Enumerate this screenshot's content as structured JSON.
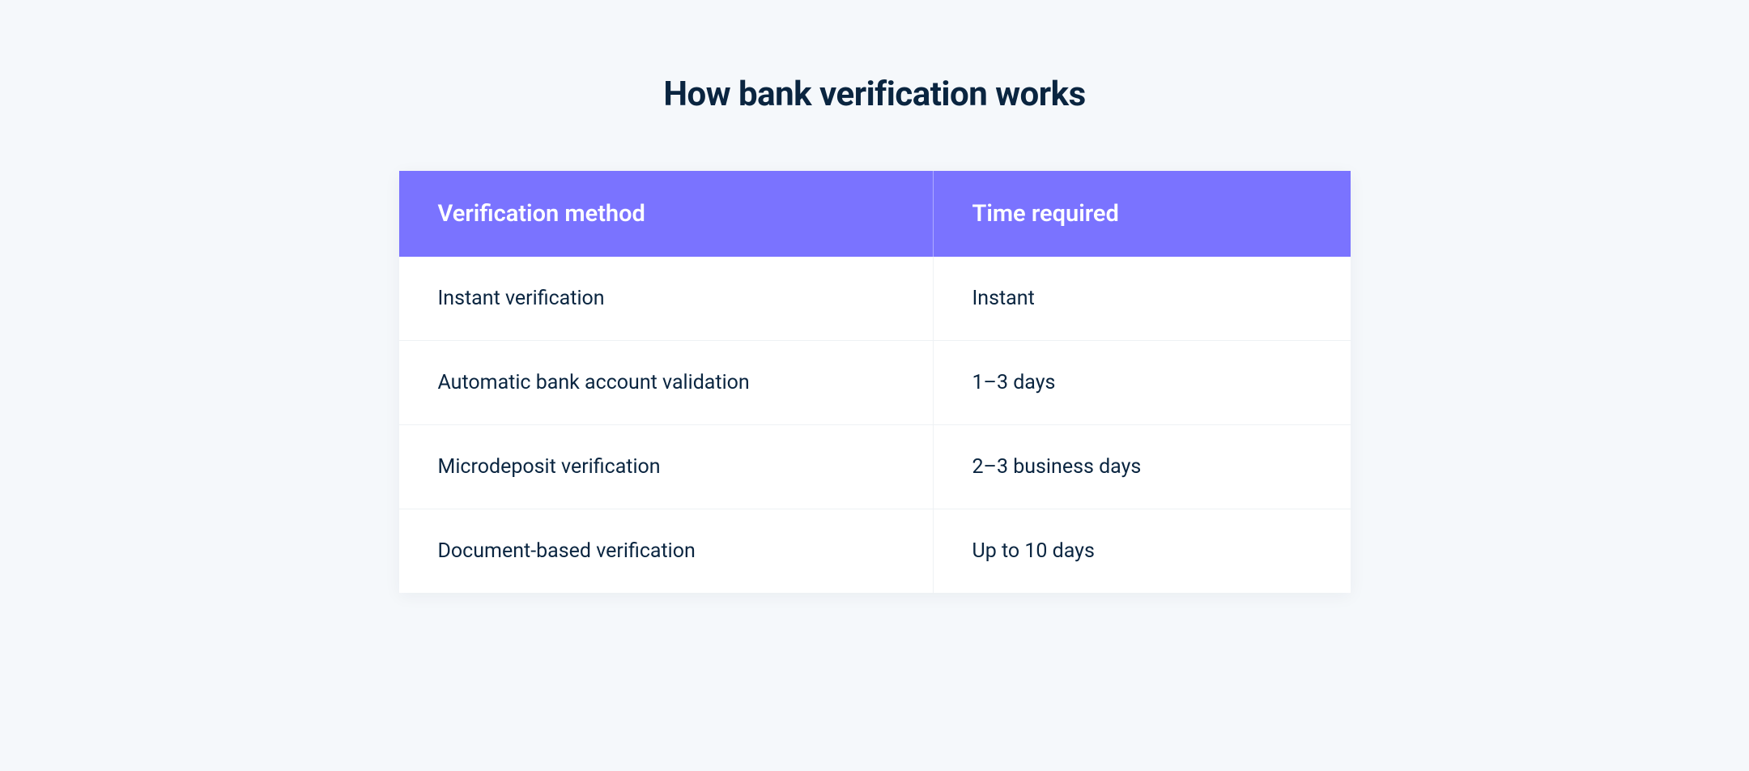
{
  "title": "How bank verification works",
  "table": {
    "headers": {
      "method": "Verification method",
      "time": "Time required"
    },
    "rows": [
      {
        "method": "Instant verification",
        "time": "Instant"
      },
      {
        "method": "Automatic bank account validation",
        "time": "1–3 days"
      },
      {
        "method": "Microdeposit verification",
        "time": "2–3 business days"
      },
      {
        "method": "Document-based verification",
        "time": "Up to 10 days"
      }
    ]
  }
}
